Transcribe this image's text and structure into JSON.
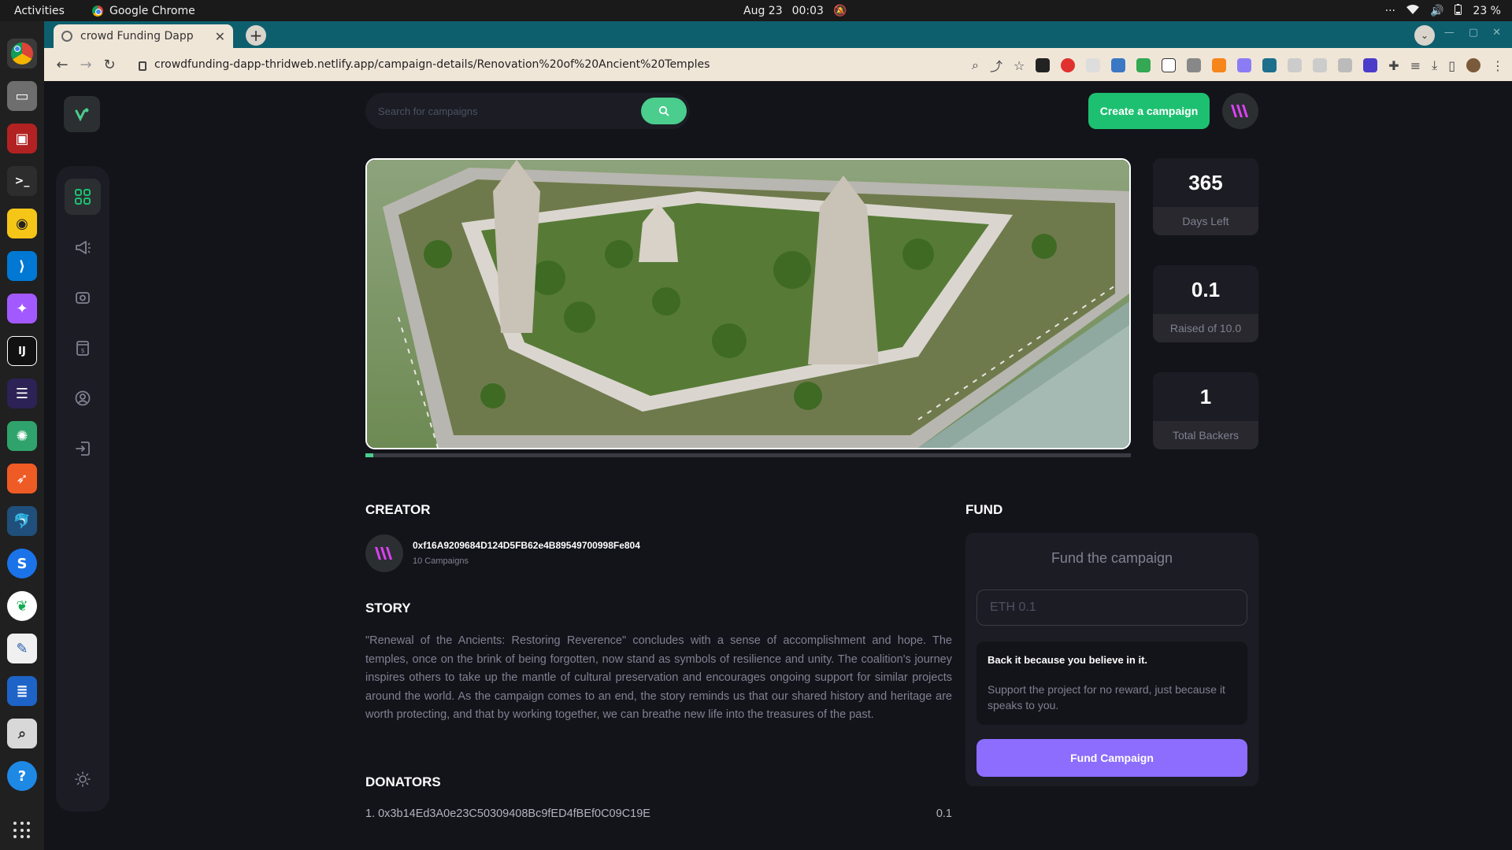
{
  "os": {
    "activities": "Activities",
    "app_name": "Google Chrome",
    "date": "Aug 23",
    "time": "00:03",
    "battery": "23 %",
    "overflow": "···"
  },
  "browser": {
    "tab_title": "crowd Funding Dapp",
    "tab_close": "✕",
    "new_tab": "+",
    "url": "crowdfunding-dapp-thridweb.netlify.app/campaign-details/Renovation%20of%20Ancient%20Temples"
  },
  "header": {
    "search_placeholder": "Search for campaigns",
    "create_label": "Create a campaign"
  },
  "stats": [
    {
      "value": "365",
      "label": "Days Left"
    },
    {
      "value": "0.1",
      "label": "Raised of 10.0"
    },
    {
      "value": "1",
      "label": "Total Backers"
    }
  ],
  "progress": {
    "raised": 0.1,
    "target": 10.0,
    "fraction": 0.01
  },
  "creator": {
    "title": "Creator",
    "address": "0xf16A9209684D124D5FB62e4B89549700998Fe804",
    "campaigns": "10 Campaigns"
  },
  "story": {
    "title": "Story",
    "text": "\"Renewal of the Ancients: Restoring Reverence\" concludes with a sense of accomplishment and hope. The temples, once on the brink of being forgotten, now stand as symbols of resilience and unity. The coalition's journey inspires others to take up the mantle of cultural preservation and encourages ongoing support for similar projects around the world. As the campaign comes to an end, the story reminds us that our shared history and heritage are worth protecting, and that by working together, we can breathe new life into the treasures of the past."
  },
  "donators": {
    "title": "Donators",
    "list": [
      {
        "entry": "1. 0x3b14Ed3A0e23C50309408Bc9fED4fBEf0C09C19E",
        "amount": "0.1"
      }
    ]
  },
  "fund": {
    "title": "Fund",
    "heading": "Fund the campaign",
    "placeholder": "ETH 0.1",
    "believe_title": "Back it because you believe in it.",
    "believe_text": "Support the project for no reward, just because it speaks to you.",
    "button": "Fund Campaign"
  },
  "colors": {
    "accent_green": "#1dc071",
    "accent_purple": "#8c6dfd",
    "background": "#13131a",
    "card": "#1c1c24"
  }
}
